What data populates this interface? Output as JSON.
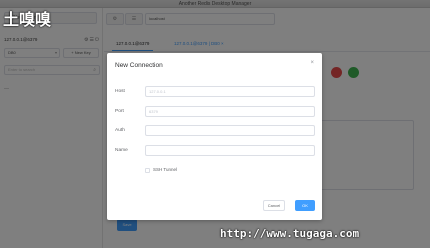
{
  "window": {
    "title": "Another Redis Desktop Manager"
  },
  "sidebar": {
    "new_connection_label": "+ New Connection",
    "connection_name": "127.0.0.1@6379",
    "db_select": "DB0",
    "new_key_label": "+ New Key",
    "search_placeholder": "Enter to search",
    "tree_item": "—"
  },
  "topbar": {
    "btn1": "⚙",
    "btn2": "☰",
    "input_value": "localhost"
  },
  "tabs": [
    {
      "label": "127.0.0.1@6379"
    },
    {
      "label": "127.0.0.1@6379 | DB0  ×"
    }
  ],
  "main": {
    "save_label": "Save"
  },
  "dialog": {
    "title": "New Connection",
    "close": "×",
    "fields": [
      {
        "label": "Host",
        "placeholder": "127.0.0.1"
      },
      {
        "label": "Port",
        "placeholder": "6379"
      },
      {
        "label": "Auth",
        "placeholder": ""
      },
      {
        "label": "Name",
        "placeholder": ""
      }
    ],
    "ssh_label": "SSH Tunnel",
    "cancel_label": "Cancel",
    "ok_label": "OK"
  },
  "watermarks": {
    "top_left": "土嗅嗅",
    "bottom_right": "http://www.tugaga.com"
  },
  "colors": {
    "primary": "#409eff",
    "danger": "#e84a4a",
    "success": "#3fb550"
  }
}
